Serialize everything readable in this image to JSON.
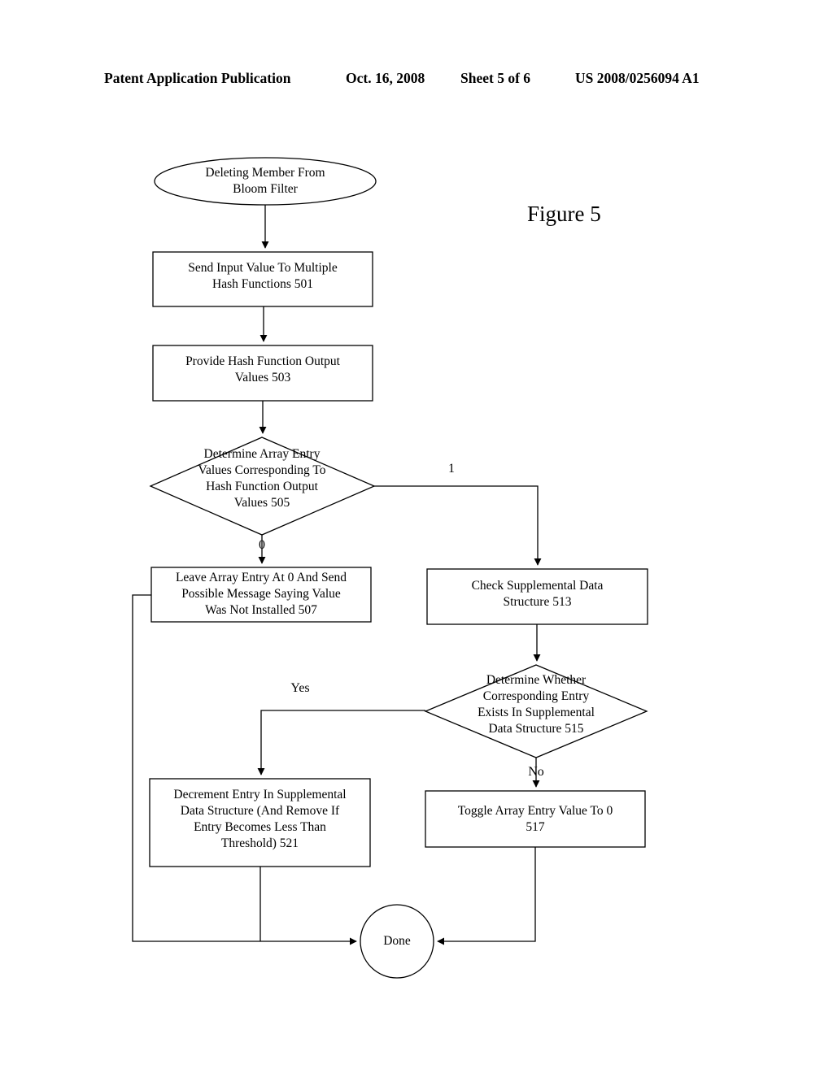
{
  "header": {
    "publication": "Patent Application Publication",
    "date": "Oct. 16, 2008",
    "sheet": "Sheet 5 of 6",
    "doc_number": "US 2008/0256094 A1"
  },
  "figure": {
    "caption": "Figure 5"
  },
  "flowchart": {
    "nodes": {
      "start": {
        "shape": "ellipse",
        "label": "Deleting Member From\nBloom Filter"
      },
      "step_501": {
        "shape": "rect",
        "label": "Send Input Value To Multiple\nHash Functions 501",
        "ref": "501"
      },
      "step_503": {
        "shape": "rect",
        "label": "Provide Hash Function Output\nValues 503",
        "ref": "503"
      },
      "decision_505": {
        "shape": "diamond",
        "label": "Determine Array Entry\nValues Corresponding To\nHash Function Output\nValues 505",
        "ref": "505"
      },
      "step_507": {
        "shape": "rect",
        "label": "Leave Array Entry At 0 And Send\nPossible Message Saying Value\nWas Not Installed 507",
        "ref": "507"
      },
      "step_513": {
        "shape": "rect",
        "label": "Check Supplemental Data\nStructure 513",
        "ref": "513"
      },
      "decision_515": {
        "shape": "diamond",
        "label": "Determine Whether\nCorresponding Entry\nExists In Supplemental\nData Structure 515",
        "ref": "515"
      },
      "step_521": {
        "shape": "rect",
        "label": "Decrement Entry In Supplemental\nData Structure (And Remove If\nEntry Becomes Less Than\nThreshold) 521",
        "ref": "521"
      },
      "step_517": {
        "shape": "rect",
        "label": "Toggle Array Entry Value To 0\n517",
        "ref": "517"
      },
      "end": {
        "shape": "circle",
        "label": "Done"
      }
    },
    "edge_labels": {
      "branch_one": "1",
      "branch_zero": "0",
      "branch_yes": "Yes",
      "branch_no": "No"
    }
  },
  "colors": {
    "ink": "#000000",
    "paper": "#ffffff"
  }
}
